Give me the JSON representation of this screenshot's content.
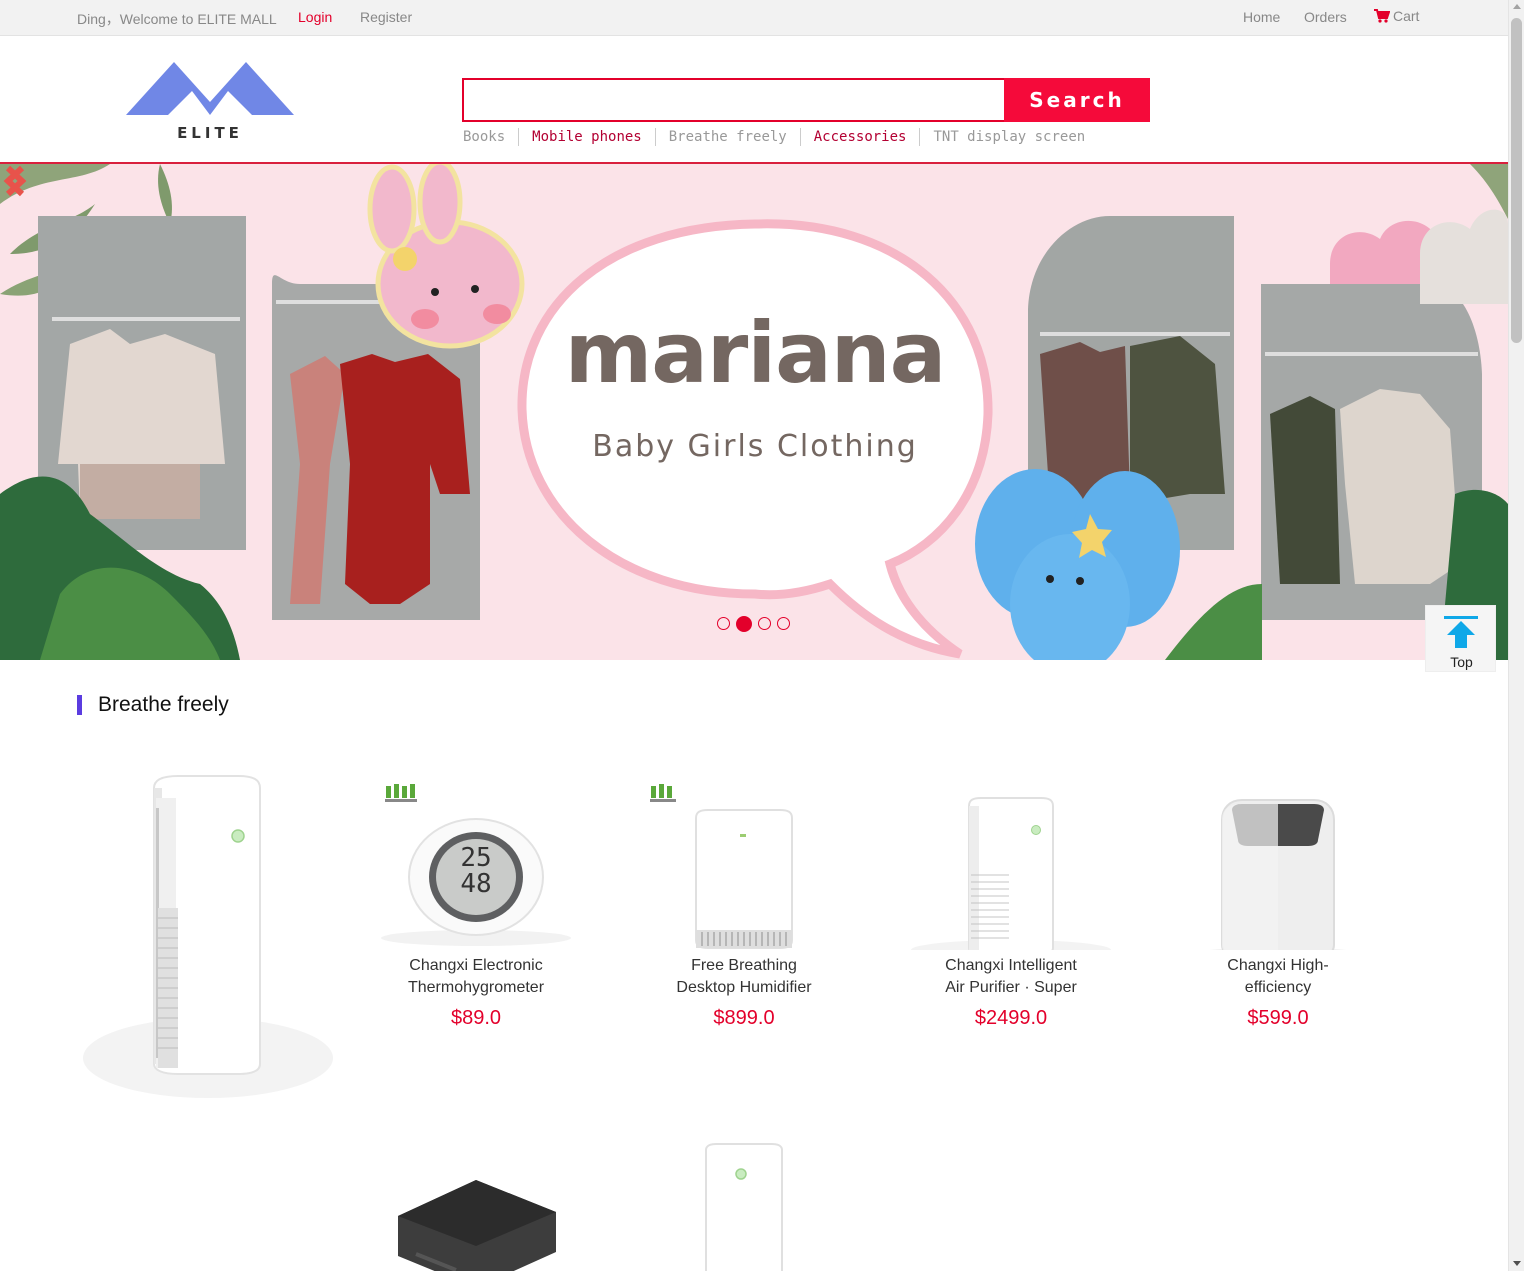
{
  "topbar": {
    "welcome": "Ding，Welcome to ELITE MALL",
    "login": "Login",
    "register": "Register",
    "home": "Home",
    "orders": "Orders",
    "cart": "Cart"
  },
  "header": {
    "logo_text": "ELITE",
    "search_value": "",
    "search_button": "Search",
    "quick_links": [
      {
        "label": "Books",
        "highlight": false
      },
      {
        "label": "Mobile phones",
        "highlight": true
      },
      {
        "label": "Breathe freely",
        "highlight": false
      },
      {
        "label": "Accessories",
        "highlight": true
      },
      {
        "label": "TNT display screen",
        "highlight": false
      }
    ]
  },
  "banner": {
    "brand": "mariana",
    "subtitle": "Baby Girls Clothing",
    "slide_count": 4,
    "active_slide": 2
  },
  "back_to_top": "Top",
  "section": {
    "title": "Breathe freely",
    "products": [
      {
        "name_line1": "Changxi Electronic",
        "name_line2": "Thermohygrometer",
        "price": "$89.0"
      },
      {
        "name_line1": "Free Breathing",
        "name_line2": "Desktop Humidifier",
        "price": "$899.0"
      },
      {
        "name_line1": "Changxi Intelligent",
        "name_line2": "Air Purifier · Super",
        "price": "$2499.0"
      },
      {
        "name_line1": "Changxi High-",
        "name_line2": "efficiency",
        "price": "$599.0"
      }
    ]
  },
  "colors": {
    "accent": "#e3002b",
    "section_bar": "#5b3ce0",
    "logo_blue": "#7087e6",
    "banner_bg": "#fbe3e8"
  }
}
